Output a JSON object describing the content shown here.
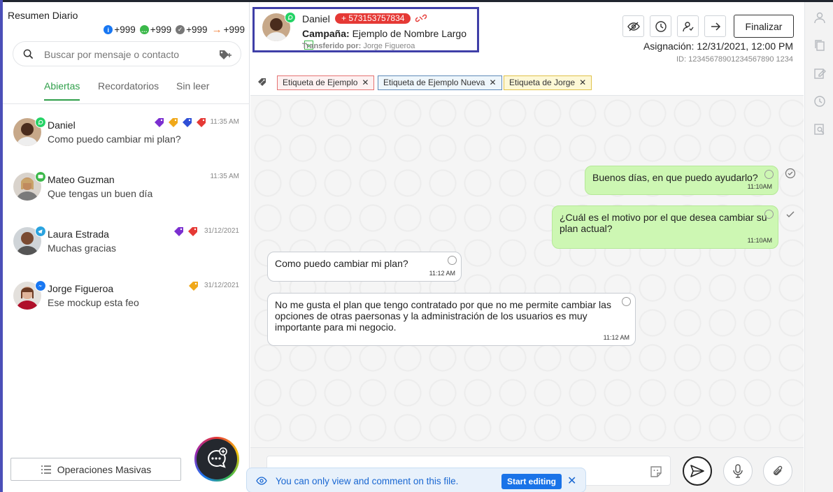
{
  "summary": {
    "title": "Resumen Diario",
    "counters": [
      {
        "icon": "facebook-icon",
        "value": "+999",
        "color": "#1877f2"
      },
      {
        "icon": "chat-icon",
        "value": "+999",
        "color": "#3bb84a"
      },
      {
        "icon": "check-icon",
        "value": "+999",
        "color": "#777777"
      },
      {
        "icon": "arrow-right-icon",
        "value": "+999",
        "color": "#f0813b"
      }
    ]
  },
  "search": {
    "placeholder": "Buscar por mensaje o contacto",
    "value": ""
  },
  "tabs": [
    {
      "label": "Abiertas",
      "active": true
    },
    {
      "label": "Recordatorios",
      "active": false
    },
    {
      "label": "Sin leer",
      "active": false
    }
  ],
  "conversations": [
    {
      "name": "Daniel",
      "message": "Como puedo cambiar mi plan?",
      "time": "11:35 AM",
      "channel": "whatsapp",
      "tags": [
        "#7b2fd0",
        "#f0a819",
        "#2f4fd6",
        "#e53935"
      ]
    },
    {
      "name": "Mateo Guzman",
      "message": "Que tengas un buen día",
      "time": "11:35 AM",
      "channel": "sms",
      "tags": []
    },
    {
      "name": "Laura Estrada",
      "message": "Muchas gracias",
      "time": "31/12/2021",
      "channel": "telegram",
      "tags": [
        "#7b2fd0",
        "#e53935"
      ]
    },
    {
      "name": "Jorge Figueroa",
      "message": "Ese mockup esta feo",
      "time": "31/12/2021",
      "channel": "messenger",
      "tags": [
        "#f0a819"
      ]
    }
  ],
  "bulk_button": {
    "label": "Operaciones Masivas"
  },
  "header": {
    "contact_name": "Daniel",
    "phone": "+ 573153757834",
    "campaign_label": "Campaña:",
    "campaign_value": "Ejemplo de Nombre Largo",
    "transfer_label": "Transferido por:",
    "transfer_value": "Jorge Figueroa",
    "finalize_label": "Finalizar",
    "assignment": "Asignación: 12/31/2021, 12:00 PM",
    "conversation_id": "ID: 12345678901234567890 1234"
  },
  "labels": [
    {
      "text": "Etiqueta de Ejemplo",
      "color": "red"
    },
    {
      "text": "Etiqueta de Ejemplo Nueva",
      "color": "blue"
    },
    {
      "text": "Etiqueta de Jorge",
      "color": "yellow"
    }
  ],
  "messages": [
    {
      "direction": "out",
      "text": "Buenos días, en que puedo ayudarlo?",
      "time": "11:10AM",
      "status": "delivered"
    },
    {
      "direction": "out",
      "text": "¿Cuál es el motivo por el que desea cambiar su plan actual?",
      "time": "11:10AM",
      "status": "sent"
    },
    {
      "direction": "in",
      "text": "Como puedo cambiar mi plan?",
      "time": "11:12 AM"
    },
    {
      "direction": "in",
      "text": "No me gusta el plan que tengo contratado por que no me permite cambiar las opciones de otras paersonas y la administración de los usuarios es muy importante para mi negocio.",
      "time": "11:12 AM"
    }
  ],
  "composer": {
    "placeholder": "",
    "value": ""
  },
  "toast": {
    "text": "You can only view and comment on this file.",
    "button": "Start editing"
  },
  "colors": {
    "accent_green": "#2f9f4a",
    "out_bubble": "#cdf7b3",
    "phone_pill": "#e53935",
    "highlight_box": "#3f3fa8"
  }
}
